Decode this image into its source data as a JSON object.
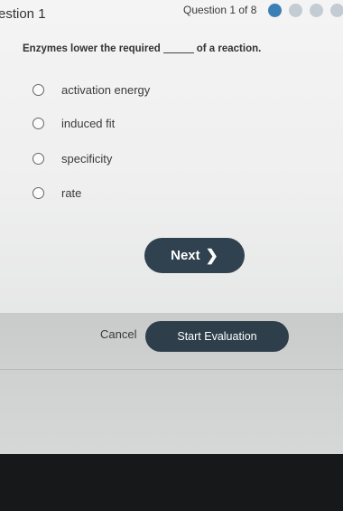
{
  "header": {
    "title": "estion 1",
    "counter": "Question 1 of 8",
    "progress_dots": 4,
    "accent_color": "#3b7fb7"
  },
  "question": {
    "text_before": "Enzymes lower the required",
    "text_after": "of a reaction."
  },
  "options": [
    {
      "label": "activation energy"
    },
    {
      "label": "induced fit"
    },
    {
      "label": "specificity"
    },
    {
      "label": "rate"
    }
  ],
  "next_button": {
    "label": "Next",
    "icon": "chevron-right-icon"
  },
  "dialog": {
    "cancel_label": "Cancel",
    "start_label": "Start Evaluation"
  }
}
